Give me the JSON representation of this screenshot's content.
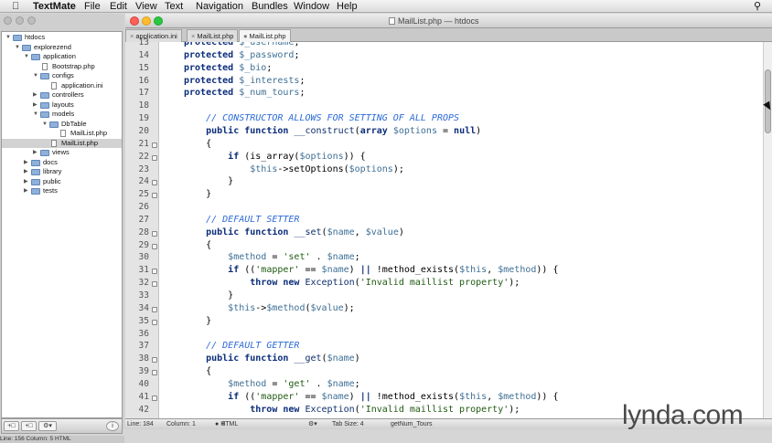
{
  "menubar": {
    "app": "TextMate",
    "items": [
      "File",
      "Edit",
      "View",
      "Text",
      "Navigation",
      "Bundles",
      "Window",
      "Help"
    ]
  },
  "drawer": {
    "tree": [
      {
        "label": "htdocs",
        "depth": 0,
        "kind": "folder",
        "open": true
      },
      {
        "label": "explorezend",
        "depth": 1,
        "kind": "folder",
        "open": true
      },
      {
        "label": "application",
        "depth": 2,
        "kind": "folder",
        "open": true
      },
      {
        "label": "Bootstrap.php",
        "depth": 3,
        "kind": "file"
      },
      {
        "label": "configs",
        "depth": 3,
        "kind": "folder",
        "open": true
      },
      {
        "label": "application.ini",
        "depth": 4,
        "kind": "file"
      },
      {
        "label": "controllers",
        "depth": 3,
        "kind": "folder",
        "open": false
      },
      {
        "label": "layouts",
        "depth": 3,
        "kind": "folder",
        "open": false
      },
      {
        "label": "models",
        "depth": 3,
        "kind": "folder",
        "open": true
      },
      {
        "label": "DbTable",
        "depth": 4,
        "kind": "folder",
        "open": true
      },
      {
        "label": "MailList.php",
        "depth": 5,
        "kind": "file"
      },
      {
        "label": "MailList.php",
        "depth": 4,
        "kind": "file",
        "selected": true
      },
      {
        "label": "views",
        "depth": 3,
        "kind": "folder",
        "open": false
      },
      {
        "label": "docs",
        "depth": 2,
        "kind": "folder",
        "open": false
      },
      {
        "label": "library",
        "depth": 2,
        "kind": "folder",
        "open": false
      },
      {
        "label": "public",
        "depth": 2,
        "kind": "folder",
        "open": false
      },
      {
        "label": "tests",
        "depth": 2,
        "kind": "folder",
        "open": false
      }
    ],
    "status": "Line: 156   Column: 5   HTML"
  },
  "window": {
    "title": "MailList.php — htdocs",
    "tabs": [
      {
        "label": "application.ini",
        "active": false
      },
      {
        "label": "MailList.php",
        "active": false
      },
      {
        "label": "MailList.php",
        "active": true
      }
    ]
  },
  "code": {
    "first_line": 13,
    "lines": [
      [
        [
          "k",
          "protected "
        ],
        [
          "v",
          "$_username"
        ],
        [
          "",
          "; "
        ]
      ],
      [
        [
          "k",
          "protected "
        ],
        [
          "v",
          "$_password"
        ],
        [
          "",
          ";"
        ]
      ],
      [
        [
          "k",
          "protected "
        ],
        [
          "v",
          "$_bio"
        ],
        [
          "",
          ";"
        ]
      ],
      [
        [
          "k",
          "protected "
        ],
        [
          "v",
          "$_interests"
        ],
        [
          "",
          ";"
        ]
      ],
      [
        [
          "k",
          "protected "
        ],
        [
          "v",
          "$_num_tours"
        ],
        [
          "",
          ";"
        ]
      ],
      [],
      [
        [
          "",
          "    "
        ],
        [
          "c",
          "// CONSTRUCTOR ALLOWS FOR SETTING OF ALL PROPS"
        ]
      ],
      [
        [
          "",
          "    "
        ],
        [
          "k",
          "public function "
        ],
        [
          "f",
          "__construct"
        ],
        [
          "",
          "("
        ],
        [
          "k",
          "array "
        ],
        [
          "v",
          "$options"
        ],
        [
          "",
          " = "
        ],
        [
          "k",
          "null"
        ],
        [
          "",
          ")"
        ]
      ],
      [
        [
          "",
          "    {"
        ]
      ],
      [
        [
          "",
          "        "
        ],
        [
          "k",
          "if "
        ],
        [
          "",
          "(is_array("
        ],
        [
          "v",
          "$options"
        ],
        [
          "",
          ")) {"
        ]
      ],
      [
        [
          "",
          "            "
        ],
        [
          "v",
          "$this"
        ],
        [
          "",
          "->setOptions("
        ],
        [
          "v",
          "$options"
        ],
        [
          "",
          ");"
        ]
      ],
      [
        [
          "",
          "        }"
        ]
      ],
      [
        [
          "",
          "    }"
        ]
      ],
      [],
      [
        [
          "",
          "    "
        ],
        [
          "c",
          "// DEFAULT SETTER"
        ]
      ],
      [
        [
          "",
          "    "
        ],
        [
          "k",
          "public function "
        ],
        [
          "f",
          "__set"
        ],
        [
          "",
          "("
        ],
        [
          "v",
          "$name"
        ],
        [
          ", ",
          ", "
        ],
        [
          "v",
          "$value"
        ],
        [
          "",
          ")"
        ]
      ],
      [
        [
          "",
          "    {"
        ]
      ],
      [
        [
          "",
          "        "
        ],
        [
          "v",
          "$method"
        ],
        [
          "",
          " = "
        ],
        [
          "s",
          "'set'"
        ],
        [
          "",
          " . "
        ],
        [
          "v",
          "$name"
        ],
        [
          "",
          ";"
        ]
      ],
      [
        [
          "",
          "        "
        ],
        [
          "k",
          "if "
        ],
        [
          "",
          "(("
        ],
        [
          "s",
          "'mapper'"
        ],
        [
          "",
          " == "
        ],
        [
          "v",
          "$name"
        ],
        [
          "",
          ") "
        ],
        [
          "k",
          "||"
        ],
        [
          "",
          " !method_exists("
        ],
        [
          "v",
          "$this"
        ],
        [
          "",
          ", "
        ],
        [
          "v",
          "$method"
        ],
        [
          "",
          ")) {"
        ]
      ],
      [
        [
          "",
          "            "
        ],
        [
          "k",
          "throw new "
        ],
        [
          "f",
          "Exception"
        ],
        [
          "",
          "("
        ],
        [
          "s",
          "'Invalid maillist property'"
        ],
        [
          "",
          ");"
        ]
      ],
      [
        [
          "",
          "        }"
        ]
      ],
      [
        [
          "",
          "        "
        ],
        [
          "v",
          "$this"
        ],
        [
          "",
          "->"
        ],
        [
          "v",
          "$method"
        ],
        [
          "",
          "("
        ],
        [
          "v",
          "$value"
        ],
        [
          "",
          ");"
        ]
      ],
      [
        [
          "",
          "    }"
        ]
      ],
      [],
      [
        [
          "",
          "    "
        ],
        [
          "c",
          "// DEFAULT GETTER"
        ]
      ],
      [
        [
          "",
          "    "
        ],
        [
          "k",
          "public function "
        ],
        [
          "f",
          "__get"
        ],
        [
          "",
          "("
        ],
        [
          "v",
          "$name"
        ],
        [
          "",
          ")"
        ]
      ],
      [
        [
          "",
          "    {"
        ]
      ],
      [
        [
          "",
          "        "
        ],
        [
          "v",
          "$method"
        ],
        [
          "",
          " = "
        ],
        [
          "s",
          "'get'"
        ],
        [
          "",
          " . "
        ],
        [
          "v",
          "$name"
        ],
        [
          "",
          ";"
        ]
      ],
      [
        [
          "",
          "        "
        ],
        [
          "k",
          "if "
        ],
        [
          "",
          "(("
        ],
        [
          "s",
          "'mapper'"
        ],
        [
          "",
          " == "
        ],
        [
          "v",
          "$name"
        ],
        [
          "",
          ") "
        ],
        [
          "k",
          "||"
        ],
        [
          "",
          " !method_exists("
        ],
        [
          "v",
          "$this"
        ],
        [
          "",
          ", "
        ],
        [
          "v",
          "$method"
        ],
        [
          "",
          ")) {"
        ]
      ],
      [
        [
          "",
          "            "
        ],
        [
          "k",
          "throw new "
        ],
        [
          "f",
          "Exception"
        ],
        [
          "",
          "("
        ],
        [
          "s",
          "'Invalid maillist property'"
        ],
        [
          "",
          ");"
        ]
      ]
    ],
    "fold_lines": [
      21,
      22,
      24,
      25,
      28,
      29,
      31,
      32,
      34,
      35,
      38,
      39,
      41
    ]
  },
  "statusbar": {
    "line": "Line: 184",
    "column": "Column: 1",
    "language": "HTML",
    "tab_size": "Tab Size:  4",
    "symbol": "getNum_Tours"
  },
  "watermark": "lynda.com"
}
